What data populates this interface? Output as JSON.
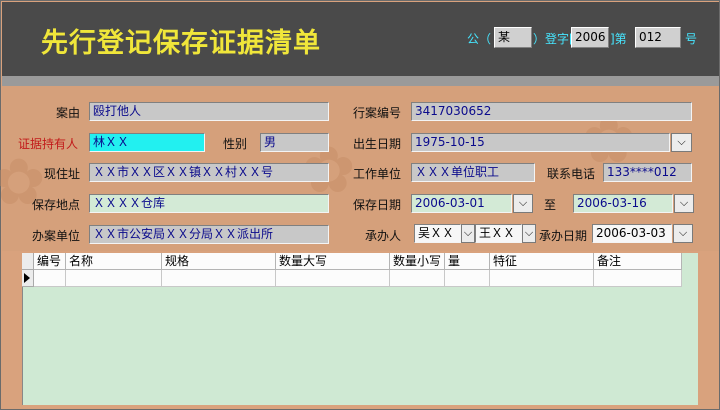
{
  "header": {
    "title": "先行登记保存证据清单",
    "prefix": "公（",
    "org_value": "某",
    "register_label": "）登字[",
    "year_value": "2006",
    "after_year": "]第",
    "number_value": "012",
    "suffix": "号"
  },
  "form": {
    "case_reason": {
      "label": "案由",
      "value": "殴打他人"
    },
    "case_no": {
      "label": "行案编号",
      "value": "3417030652"
    },
    "holder": {
      "label": "证据持有人",
      "value": "林ＸＸ"
    },
    "gender": {
      "label": "性别",
      "value": "男"
    },
    "birth": {
      "label": "出生日期",
      "value": "1975-10-15"
    },
    "address": {
      "label": "现住址",
      "value": "ＸＸ市ＸＸ区ＸＸ镇ＸＸ村ＸＸ号"
    },
    "employer": {
      "label": "工作单位",
      "value": "ＸＸＸ单位职工"
    },
    "phone": {
      "label": "联系电话",
      "value": "133****012"
    },
    "location": {
      "label": "保存地点",
      "value": "ＸＸＸＸ仓库"
    },
    "save_date": {
      "label": "保存日期",
      "value": "2006-03-01"
    },
    "to": {
      "label": "至",
      "value": "2006-03-16"
    },
    "office": {
      "label": "办案单位",
      "value": "ＸＸ市公安局ＸＸ分局ＸＸ派出所"
    },
    "handler": {
      "label": "承办人",
      "value1": "吴ＸＸ",
      "value2": "王ＸＸ"
    },
    "handle_date": {
      "label": "承办日期",
      "value": "2006-03-03"
    }
  },
  "grid": {
    "columns": [
      "编号",
      "名称",
      "规格",
      "数量大写",
      "数量小写",
      "量",
      "特征",
      "备注"
    ],
    "rows": [
      [
        "",
        "",
        "",
        "",
        "",
        "",
        "",
        ""
      ]
    ]
  },
  "icons": {
    "dropdown": "chevron-down-icon",
    "row_pointer": "row-pointer-icon",
    "stepper": "stepper-icon"
  },
  "colors": {
    "header_bg": "#4a4a4a",
    "title": "#f0e63a",
    "accent_cyan": "#46e6ff",
    "form_bg": "#d5a07b",
    "grid_bg": "#cfe9d3"
  }
}
